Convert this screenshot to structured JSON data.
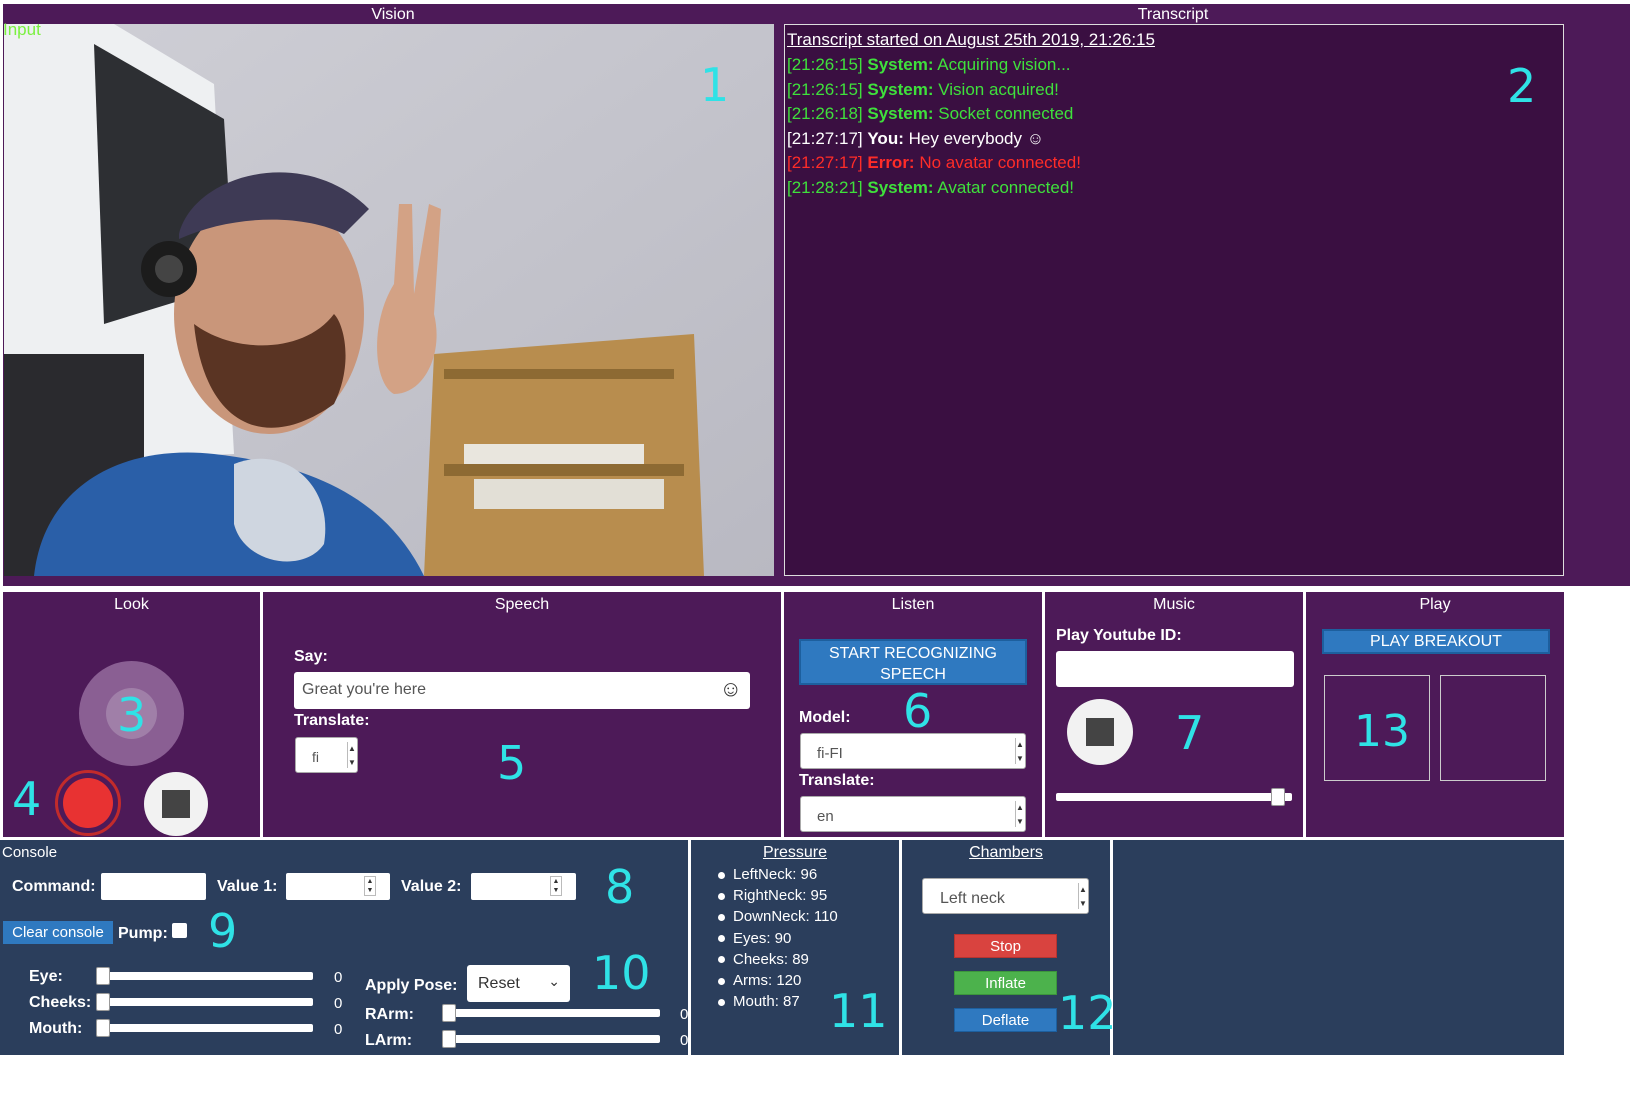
{
  "vision": {
    "header": "Vision",
    "input_label": "Input",
    "annotation": "1"
  },
  "transcript": {
    "header": "Transcript",
    "started": "Transcript started on August 25th 2019, 21:26:15",
    "annotation": "2",
    "lines": [
      {
        "time": "[21:26:15]",
        "who": "System:",
        "text": "Acquiring vision...",
        "color": "#3fe03c"
      },
      {
        "time": "[21:26:15]",
        "who": "System:",
        "text": "Vision acquired!",
        "color": "#3fe03c"
      },
      {
        "time": "[21:26:18]",
        "who": "System:",
        "text": "Socket connected",
        "color": "#3fe03c"
      },
      {
        "time": "[21:27:17]",
        "who": "You:",
        "text": "Hey everybody ☺",
        "color": "#ffffff"
      },
      {
        "time": "[21:27:17]",
        "who": "Error:",
        "text": "No avatar connected!",
        "color": "#ff2c28"
      },
      {
        "time": "[21:28:21]",
        "who": "System:",
        "text": "Avatar connected!",
        "color": "#3fe03c"
      }
    ]
  },
  "look": {
    "header": "Look",
    "annotation_main": "3",
    "annotation_record": "4"
  },
  "speech": {
    "header": "Speech",
    "say_label": "Say:",
    "say_value": "Great you're here",
    "translate_label": "Translate:",
    "translate_value": "fi",
    "annotation": "5"
  },
  "listen": {
    "header": "Listen",
    "button_line1": "START RECOGNIZING",
    "button_line2": "SPEECH",
    "model_label": "Model:",
    "model_value": "fi-FI",
    "translate_label": "Translate:",
    "translate_value": "en",
    "annotation": "6"
  },
  "music": {
    "header": "Music",
    "youtube_label": "Play Youtube ID:",
    "youtube_value": "",
    "annotation": "7",
    "volume_fraction": 0.97
  },
  "play": {
    "header": "Play",
    "button": "PLAY BREAKOUT",
    "annotation": "13"
  },
  "console": {
    "header": "Console",
    "command_label": "Command:",
    "value1_label": "Value 1:",
    "value2_label": "Value 2:",
    "clear_button": "Clear console",
    "pump_label": "Pump:",
    "apply_pose_label": "Apply Pose:",
    "apply_pose_value": "Reset",
    "annotation_inputs": "8",
    "annotation_clear": "9",
    "annotation_sliders": "10",
    "sliders": {
      "eye": {
        "label": "Eye:",
        "value": "0"
      },
      "cheeks": {
        "label": "Cheeks:",
        "value": "0"
      },
      "mouth": {
        "label": "Mouth:",
        "value": "0"
      },
      "rarm": {
        "label": "RArm:",
        "value": "0"
      },
      "larm": {
        "label": "LArm:",
        "value": "0"
      }
    }
  },
  "pressure": {
    "header": "Pressure",
    "annotation": "11",
    "items": [
      "LeftNeck: 96",
      "RightNeck: 95",
      "DownNeck: 110",
      "Eyes: 90",
      "Cheeks: 89",
      "Arms: 120",
      "Mouth: 87"
    ]
  },
  "chambers": {
    "header": "Chambers",
    "select_value": "Left neck",
    "stop": "Stop",
    "inflate": "Inflate",
    "deflate": "Deflate",
    "annotation": "12"
  },
  "colors": {
    "panel_purple": "#4d1a58",
    "transcript_bg": "#3a0f41",
    "console_navy": "#2b3e5c",
    "annotation_cyan": "#2fe2e6",
    "record_red": "#e83232",
    "button_blue": "#2f79c0",
    "stop_red": "#d9433f",
    "inflate_green": "#4cb24c"
  }
}
